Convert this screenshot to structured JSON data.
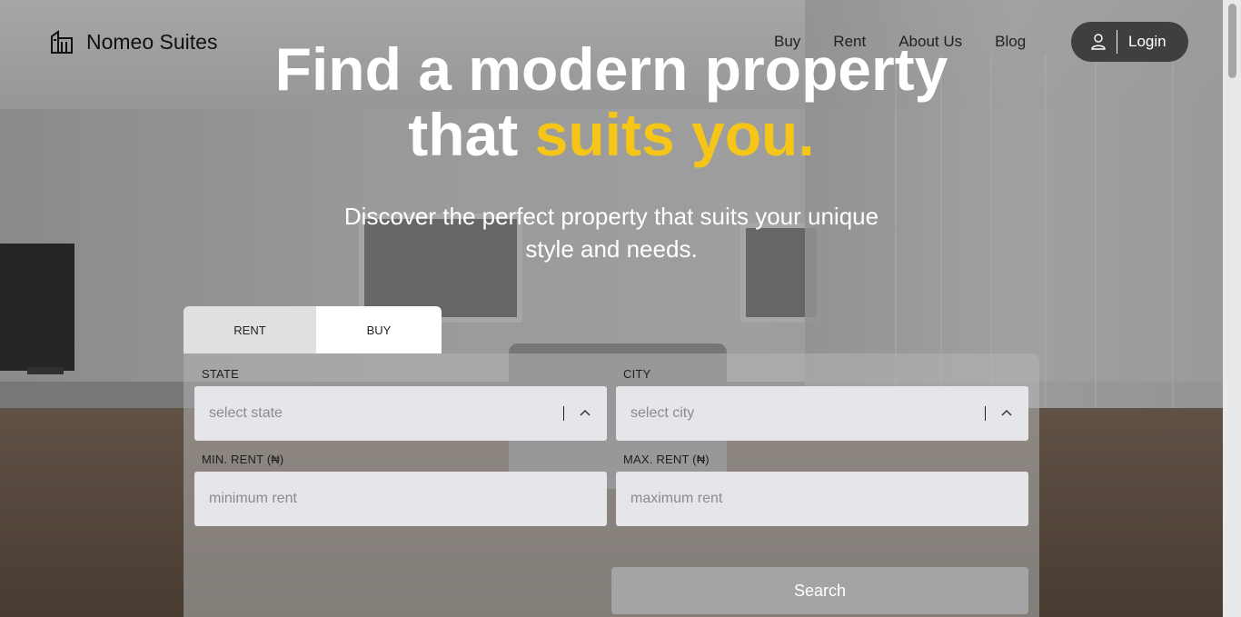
{
  "brand": {
    "name": "Nomeo Suites",
    "icon": "building-icon"
  },
  "nav": {
    "items": [
      "Buy",
      "Rent",
      "About Us",
      "Blog"
    ]
  },
  "login": {
    "label": "Login",
    "icon": "user-icon"
  },
  "hero": {
    "title_line1": "Find a modern property",
    "title_line2_plain": "that ",
    "title_line2_accent": "suits you.",
    "subtitle_line1": "Discover the perfect property that suits your unique",
    "subtitle_line2": "style and needs."
  },
  "search": {
    "tabs": [
      "RENT",
      "BUY"
    ],
    "state": {
      "label": "STATE",
      "placeholder": "select state"
    },
    "city": {
      "label": "CITY",
      "placeholder": "select city"
    },
    "min_rent": {
      "label": "MIN. RENT (₦)",
      "placeholder": "minimum rent"
    },
    "max_rent": {
      "label": "MAX. RENT (₦)",
      "placeholder": "maximum rent"
    },
    "button": "Search"
  },
  "colors": {
    "accent": "#f5c518",
    "login_bg": "#3f3f3f",
    "input_bg": "#e6e6ea",
    "search_btn": "#a4a4a4"
  }
}
